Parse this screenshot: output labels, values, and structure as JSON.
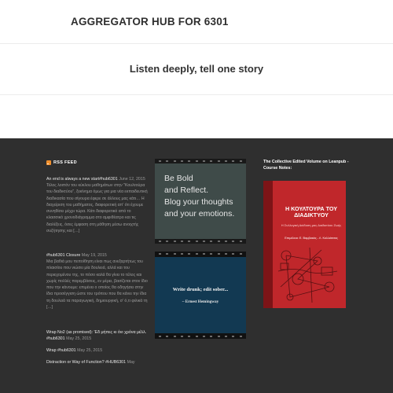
{
  "header": {
    "site_title": "AGGREGATOR HUB FOR 6301",
    "tagline": "Listen deeply, tell one story"
  },
  "footer": {
    "rss": {
      "title": "RSS FEED",
      "icon": "rss-icon",
      "items": [
        {
          "link": "An end is always a new start#hub6301",
          "date": "June 12, 2015",
          "excerpt": "Τέλος λοιπόν του κύκλου μαθημάτων στην \"Κουλτούρα του διαδικτύου\", ξεκίνημα όμως για μια νέα εκπαιδευτική διαδικασία που σίγουρα έφερε σε άλλους μας κάτι… Η διαχείριση του μαθήματος, διαφορετική απ' ότι έχουμε συνηθίσει μέχρι τώρα. Κάτι διαφορετικό από το κλασσικό χρονοδιάγραμμα στο αμφιθέατρο και τις διαλέξεις, όσες έμφαση στη μάθηση μέσω ανοιχτής συζήτησης και […]"
        },
        {
          "link": "#hub6301 Closure",
          "date": "May 19, 2015",
          "excerpt": "Μια βαθιά μου πεποίθηση είναι πως ανεξαρτήτως του πλαισίου που νιώσει μία δουλειά, αλλά και του περιεχομένου της, το πόσο καλά θα γίνει το τέλος και χωρίς πολλές παρεμβάσεις, εν μέρει, βασίζεται στον ίδιο που την κάνουμε: επιμένει ο οποίος θα οδηγήσει στην ίδια προσέγγιση ώστε του τρόπου που θα κάνει την ίδια τη δουλειά τα παραγωγική, δημιουργική, σ' ό,τι φιλικά τη […]"
        },
        {
          "link": "Wrap No2 (as promised): 'Εδ μήπες κι όνι χρόνα μέλλ. #hub6301",
          "date": "May 25, 2015",
          "excerpt": ""
        },
        {
          "link": "Wrap #hub6301",
          "date": "May 25, 2015",
          "excerpt": ""
        },
        {
          "link": "Distraction or Way of Function? #HUB6301",
          "date": "May",
          "excerpt": ""
        }
      ]
    },
    "bold_widget": {
      "text": "Be Bold\nand Reflect.\nBlog your thoughts\nand your emotions."
    },
    "write_widget": {
      "quote": "Write drunk; edit sober...",
      "author": "~ Ernest Hemingway"
    },
    "book": {
      "caption": "The Collective Edited Volume on Leanpub - Course Notes:",
      "cover_title": "Η ΚΟΥΛΤΟΥΡΑ ΤΟΥ ΔΙΑΔΙΚΤΥΟΥ",
      "cover_subtitle": "Η Συλλογική Διάδοση μας Διαδικτύου Ζωής",
      "cover_editors": "Επιμέλεια: Ε. Βαμβακάς - Λ. Κολλιάτσας",
      "spine_color": "#7d1417",
      "cover_color": "#c0272b"
    }
  }
}
